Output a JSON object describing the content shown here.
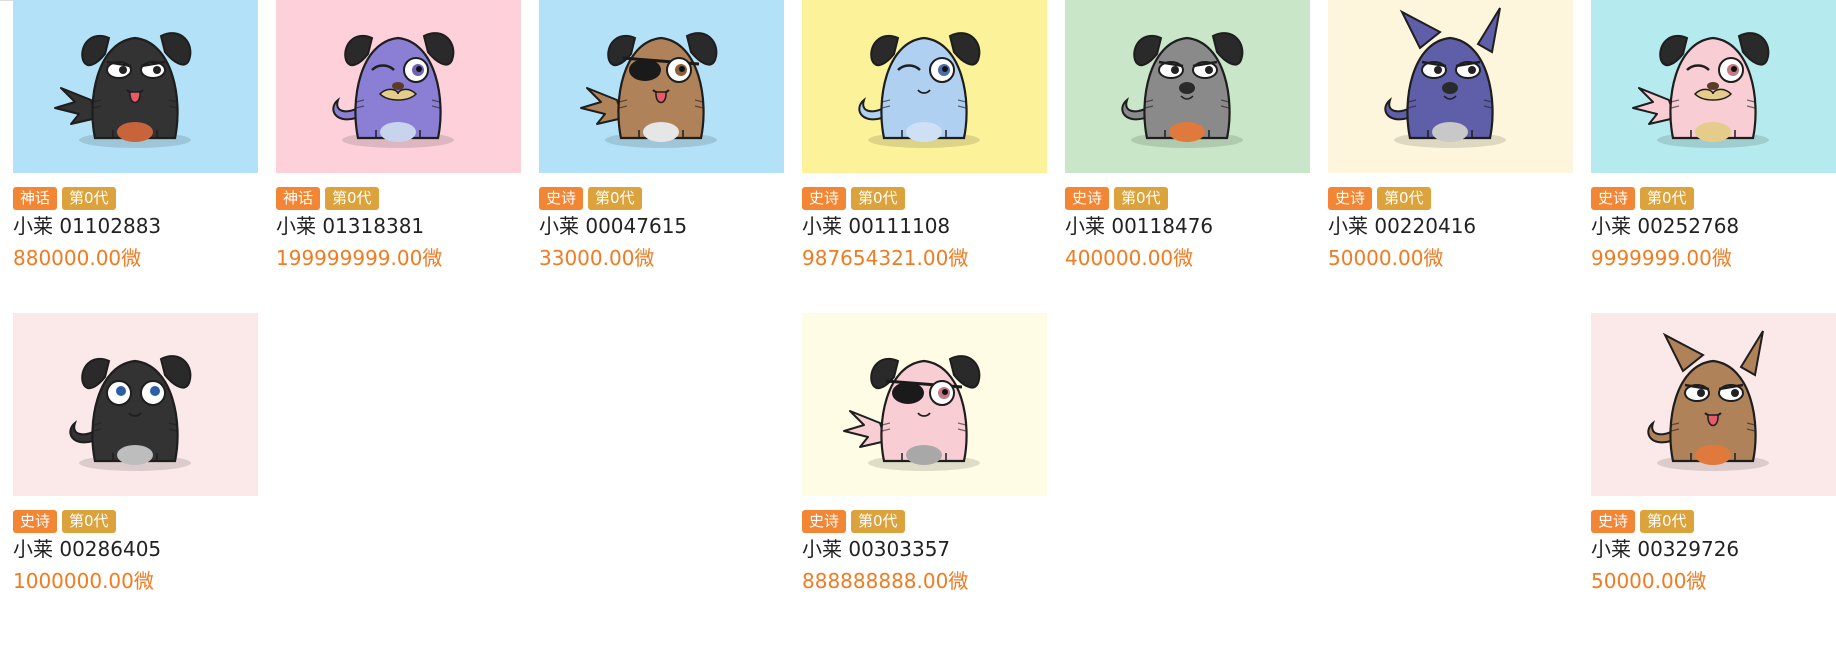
{
  "items": [
    {
      "rarity": "神话",
      "gen": "第0代",
      "name": "小莱 01102883",
      "price": "880000.00微",
      "bg": "#b3e2f8",
      "body": "#333333",
      "belly": "#c8643c",
      "tail": "lightning",
      "eyes": "squint",
      "ears": "floppy",
      "mouth": "tongue",
      "accent": "#7bb3e8"
    },
    {
      "rarity": "神话",
      "gen": "第0代",
      "name": "小莱 01318381",
      "price": "199999999.00微",
      "bg": "#fdd0da",
      "body": "#8a7fd4",
      "belly": "#c8d4ee",
      "tail": "curl",
      "eyes": "wink",
      "ears": "floppy",
      "mouth": "mustache",
      "accent": "#6f61b8"
    },
    {
      "rarity": "史诗",
      "gen": "第0代",
      "name": "小莱 00047615",
      "price": "33000.00微",
      "bg": "#b3e2f8",
      "body": "#b0825a",
      "belly": "#e6e6e6",
      "tail": "lightning",
      "eyes": "patch",
      "ears": "floppy",
      "mouth": "tongue",
      "accent": "#8a5f3c"
    },
    {
      "rarity": "史诗",
      "gen": "第0代",
      "name": "小莱 00111108",
      "price": "987654321.00微",
      "bg": "#fcf29a",
      "body": "#b0d0f2",
      "belly": "#cfe0f5",
      "tail": "curl",
      "eyes": "wink",
      "ears": "floppy",
      "mouth": "small",
      "accent": "#4a6ea8"
    },
    {
      "rarity": "史诗",
      "gen": "第0代",
      "name": "小莱 00118476",
      "price": "400000.00微",
      "bg": "#c9e6c8",
      "body": "#8a8a8a",
      "belly": "#e07a3c",
      "tail": "curl",
      "eyes": "squint",
      "ears": "floppy",
      "mouth": "nose",
      "accent": "#5c5c5c"
    },
    {
      "rarity": "史诗",
      "gen": "第0代",
      "name": "小莱 00220416",
      "price": "50000.00微",
      "bg": "#fdf6dc",
      "body": "#5e5fa8",
      "belly": "#c8c8c8",
      "tail": "curl",
      "eyes": "squint",
      "ears": "pointy",
      "mouth": "nose",
      "accent": "#3e3f80"
    },
    {
      "rarity": "史诗",
      "gen": "第0代",
      "name": "小莱 00252768",
      "price": "9999999.00微",
      "bg": "#b5ebee",
      "body": "#f8cdd4",
      "belly": "#e6cc8a",
      "tail": "lightning",
      "eyes": "wink",
      "ears": "floppy",
      "mouth": "mustache",
      "accent": "#c47a84"
    },
    {
      "rarity": "史诗",
      "gen": "第0代",
      "name": "小莱 00286405",
      "price": "1000000.00微",
      "bg": "#fbe8e8",
      "body": "#333333",
      "belly": "#bdbdbd",
      "tail": "curl",
      "eyes": "round",
      "ears": "floppy",
      "mouth": "small",
      "accent": "#555555"
    },
    {
      "rarity": "史诗",
      "gen": "第0代",
      "name": "小莱 00303357",
      "price": "888888888.00微",
      "bg": "#fefce4",
      "body": "#f8cdd4",
      "belly": "#a8a8a8",
      "tail": "lightning",
      "eyes": "patch",
      "ears": "floppy",
      "mouth": "small",
      "accent": "#c47a84"
    },
    {
      "rarity": "史诗",
      "gen": "第0代",
      "name": "小莱 00329726",
      "price": "50000.00微",
      "bg": "#fbe8e8",
      "body": "#b0825a",
      "belly": "#e07a3c",
      "tail": "curl",
      "eyes": "squint",
      "ears": "pointy",
      "mouth": "tongue",
      "accent": "#8a5f3c"
    }
  ]
}
